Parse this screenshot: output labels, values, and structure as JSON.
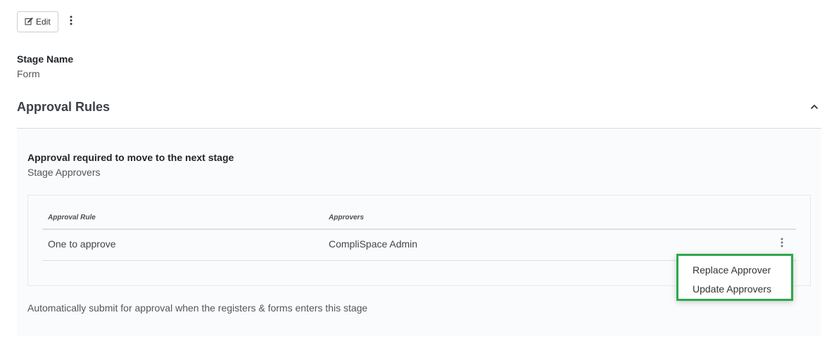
{
  "toolbar": {
    "edit_label": "Edit"
  },
  "stage": {
    "label": "Stage Name",
    "value": "Form"
  },
  "section": {
    "title": "Approval Rules"
  },
  "rules": {
    "title": "Approval required to move to the next stage",
    "subtitle": "Stage Approvers",
    "table": {
      "headers": [
        "Approval Rule",
        "Approvers"
      ],
      "rows": [
        [
          "One to approve",
          "CompliSpace Admin"
        ]
      ]
    },
    "auto_submit": "Automatically submit for approval when the registers & forms enters this stage"
  },
  "menu": {
    "items": [
      "Replace Approver",
      "Update Approvers"
    ]
  },
  "colors": {
    "highlight": "#2ea84a"
  },
  "icons": {
    "edit": "edit-icon",
    "more": "kebab-icon",
    "collapse": "chevron-up-icon"
  }
}
